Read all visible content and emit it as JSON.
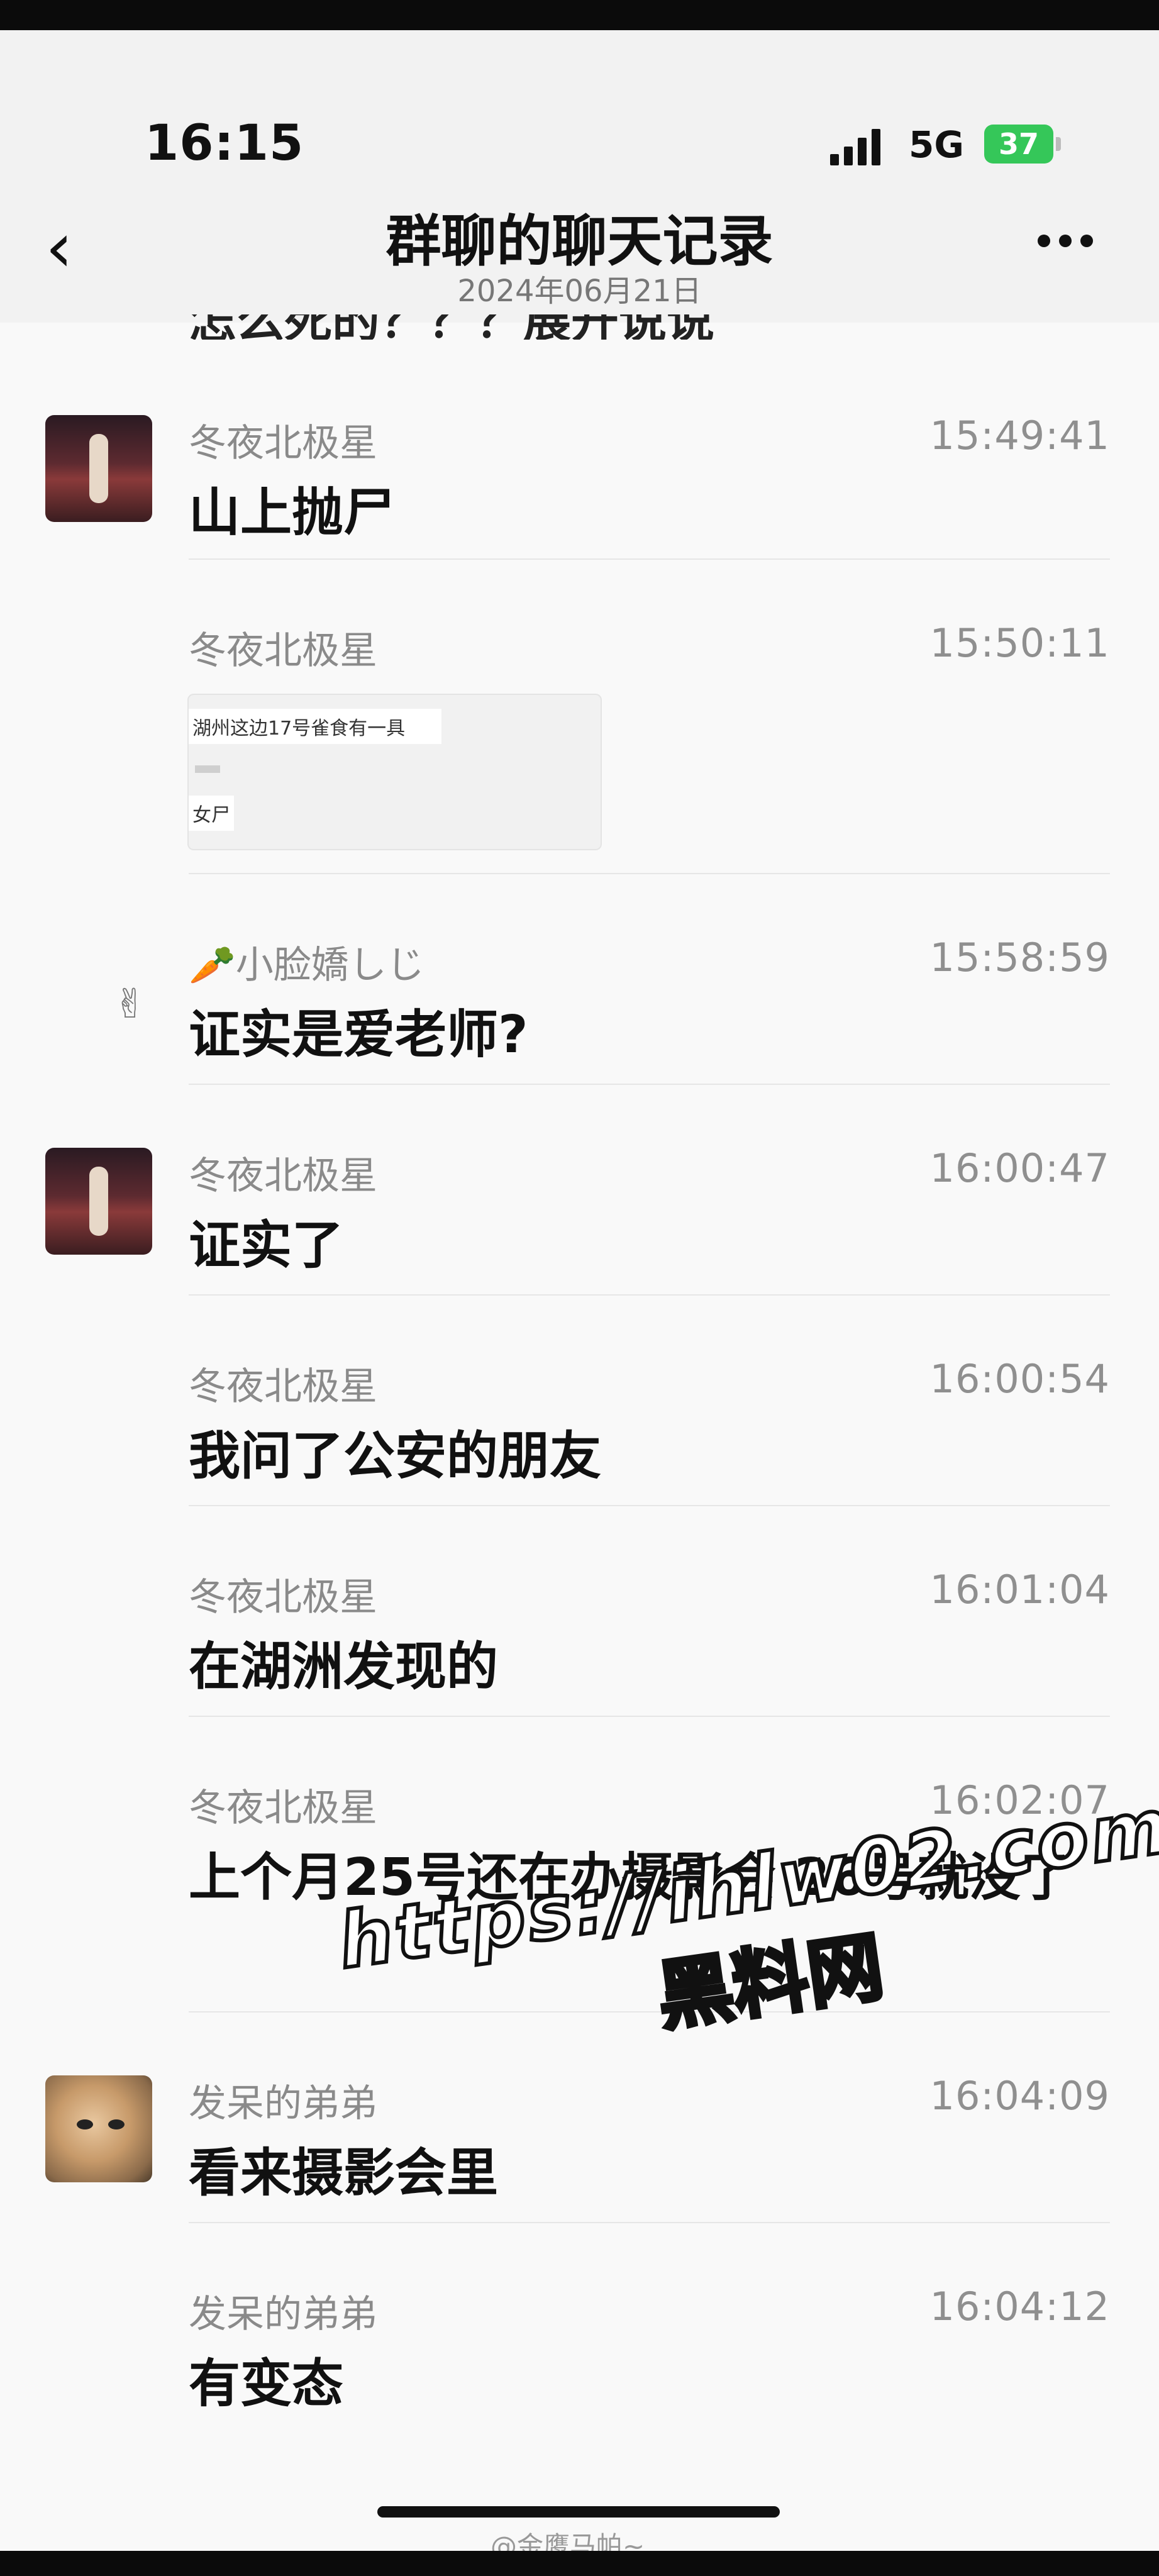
{
  "status": {
    "time": "16:15",
    "network": "5G",
    "battery": "37"
  },
  "nav": {
    "back_icon": "‹",
    "title": "群聊的聊天记录",
    "date": "2024年06月21日",
    "more_icon": "more-dots"
  },
  "clipped_text": "怎么死的？？？展开说说",
  "messages": [
    {
      "name": "冬夜北极星",
      "time": "15:49:41",
      "text": "山上抛尸"
    },
    {
      "name": "冬夜北极星",
      "time": "15:50:11",
      "image": {
        "line1": "湖州这边17号雀食有一具",
        "line2": "女尸"
      }
    },
    {
      "name": "🥕小脸嬌しじ",
      "time": "15:58:59",
      "text": "证实是爱老师?"
    },
    {
      "name": "冬夜北极星",
      "time": "16:00:47",
      "text": "证实了"
    },
    {
      "name": "冬夜北极星",
      "time": "16:00:54",
      "text": "我问了公安的朋友"
    },
    {
      "name": "冬夜北极星",
      "time": "16:01:04",
      "text": "在湖洲发现的"
    },
    {
      "name": "冬夜北极星",
      "time": "16:02:07",
      "text": "上个月25号还在办摄影会 26号就没了"
    },
    {
      "name": "发呆的弟弟",
      "time": "16:04:09",
      "text": "看来摄影会里"
    },
    {
      "name": "发呆的弟弟",
      "time": "16:04:12",
      "text": "有变态"
    }
  ],
  "watermark": {
    "url": "https://ihlw02.com",
    "name": "黑料网"
  },
  "credit": "@金鹰马帕~"
}
